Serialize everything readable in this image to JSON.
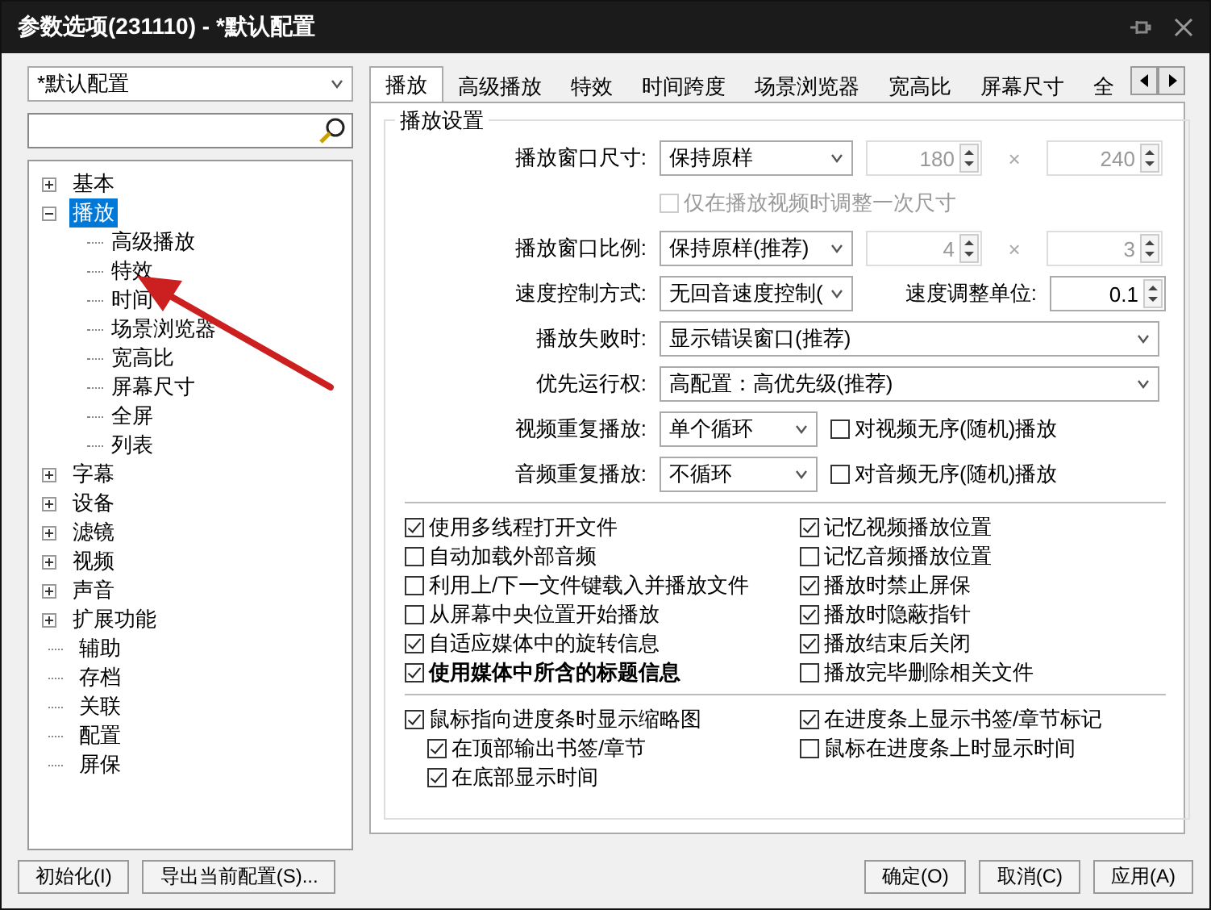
{
  "window": {
    "title": "参数选项(231110) - *默认配置"
  },
  "profile_select": {
    "value": "*默认配置"
  },
  "tree": [
    {
      "label": "基本",
      "selected": false,
      "expanded": false
    },
    {
      "label": "播放",
      "selected": true,
      "expanded": true,
      "children": [
        {
          "label": "高级播放",
          "selected": false
        },
        {
          "label": "特效",
          "selected": false
        },
        {
          "label": "时间",
          "selected": false
        },
        {
          "label": "场景浏览器",
          "selected": false
        },
        {
          "label": "宽高比",
          "selected": false
        },
        {
          "label": "屏幕尺寸",
          "selected": false
        },
        {
          "label": "全屏",
          "selected": false
        },
        {
          "label": "列表",
          "selected": false
        }
      ]
    },
    {
      "label": "字幕",
      "selected": false,
      "expanded": false
    },
    {
      "label": "设备",
      "selected": false,
      "expanded": false
    },
    {
      "label": "滤镜",
      "selected": false,
      "expanded": false
    },
    {
      "label": "视频",
      "selected": false,
      "expanded": false
    },
    {
      "label": "声音",
      "selected": false,
      "expanded": false
    },
    {
      "label": "扩展功能",
      "selected": false,
      "expanded": false
    },
    {
      "label": "辅助",
      "selected": false
    },
    {
      "label": "存档",
      "selected": false
    },
    {
      "label": "关联",
      "selected": false
    },
    {
      "label": "配置",
      "selected": false
    },
    {
      "label": "屏保",
      "selected": false
    }
  ],
  "tabs": [
    {
      "label": "播放",
      "selected": true
    },
    {
      "label": "高级播放",
      "selected": false
    },
    {
      "label": "特效",
      "selected": false
    },
    {
      "label": "时间跨度",
      "selected": false
    },
    {
      "label": "场景浏览器",
      "selected": false
    },
    {
      "label": "宽高比",
      "selected": false
    },
    {
      "label": "屏幕尺寸",
      "selected": false
    },
    {
      "label": "全",
      "selected": false
    }
  ],
  "group": {
    "title": "播放设置",
    "rows": [
      {
        "kind": "size",
        "label": "播放窗口尺寸:",
        "value": "保持原样",
        "spin_a": {
          "value": "180",
          "disabled": true
        },
        "spin_b": {
          "value": "240",
          "disabled": true
        },
        "separator": "×"
      },
      {
        "kind": "note",
        "label": "仅在播放视频时调整一次尺寸",
        "checked": false,
        "disabled": true
      },
      {
        "kind": "size",
        "label": "播放窗口比例:",
        "value": "保持原样(推荐)",
        "spin_a": {
          "value": "4",
          "disabled": true
        },
        "spin_b": {
          "value": "3",
          "disabled": true
        },
        "separator": "×"
      },
      {
        "kind": "speed",
        "label": "速度控制方式:",
        "value": "无回音速度控制(",
        "unit_label": "速度调整单位:",
        "spin_a": {
          "value": "0.1",
          "disabled": false
        }
      },
      {
        "kind": "wide",
        "label": "播放失败时:",
        "value": "显示错误窗口(推荐)"
      },
      {
        "kind": "wide",
        "label": "优先运行权:",
        "value": "高配置：高优先级(推荐)"
      },
      {
        "kind": "repeat",
        "label": "视频重复播放:",
        "value": "单个循环",
        "option": {
          "label": "对视频无序(随机)播放",
          "checked": false
        }
      },
      {
        "kind": "repeat",
        "label": "音频重复播放:",
        "value": "不循环",
        "option": {
          "label": "对音频无序(随机)播放",
          "checked": false
        }
      }
    ],
    "sections": [
      {
        "left": [
          {
            "label": "使用多线程打开文件",
            "checked": true
          },
          {
            "label": "自动加载外部音频",
            "checked": false
          },
          {
            "label": "利用上/下一文件键载入并播放文件",
            "checked": false
          },
          {
            "label": "从屏幕中央位置开始播放",
            "checked": false
          },
          {
            "label": "自适应媒体中的旋转信息",
            "checked": true
          },
          {
            "label": "使用媒体中所含的标题信息",
            "checked": true,
            "bold": true
          }
        ],
        "right": [
          {
            "label": "记忆视频播放位置",
            "checked": true
          },
          {
            "label": "记忆音频播放位置",
            "checked": false
          },
          {
            "label": "播放时禁止屏保",
            "checked": true
          },
          {
            "label": "播放时隐蔽指针",
            "checked": true
          },
          {
            "label": "播放结束后关闭",
            "checked": true
          },
          {
            "label": "播放完毕删除相关文件",
            "checked": false
          }
        ]
      },
      {
        "left": [
          {
            "label": "鼠标指向进度条时显示缩略图",
            "checked": true,
            "children": [
              {
                "label": "在顶部输出书签/章节",
                "checked": true
              },
              {
                "label": "在底部显示时间",
                "checked": true
              }
            ]
          }
        ],
        "right": [
          {
            "label": "在进度条上显示书签/章节标记",
            "checked": true
          },
          {
            "label": "鼠标在进度条上时显示时间",
            "checked": false
          }
        ]
      }
    ]
  },
  "left_buttons": [
    "初始化(I)",
    "导出当前配置(S)..."
  ],
  "right_buttons": [
    "确定(O)",
    "取消(C)",
    "应用(A)"
  ]
}
